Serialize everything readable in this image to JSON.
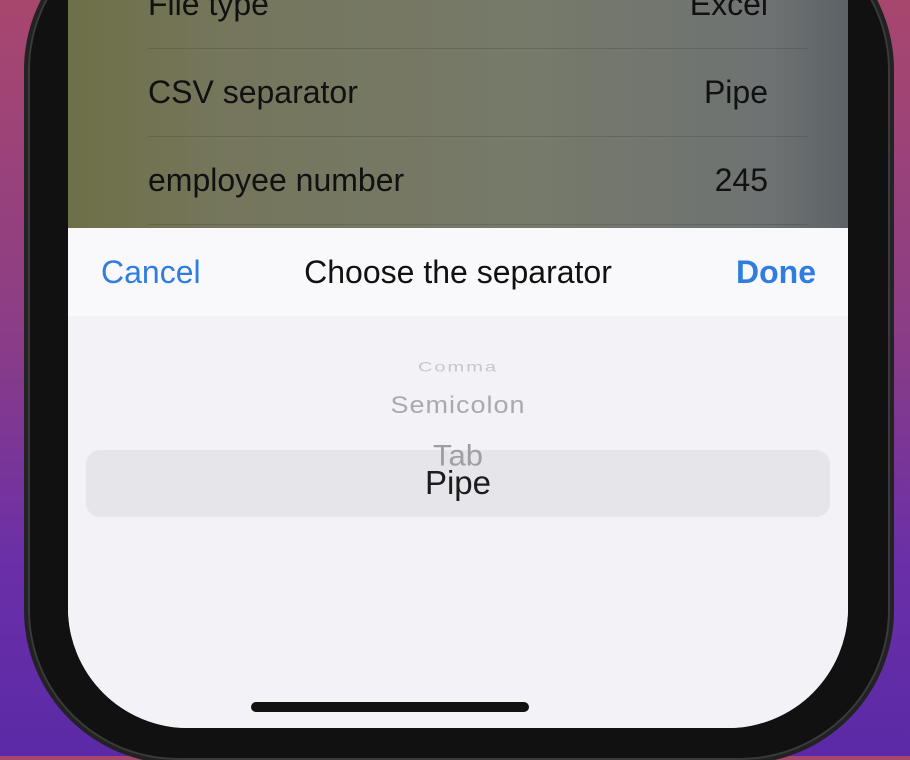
{
  "settings": {
    "rows": [
      {
        "label": "File type",
        "value": "Excel"
      },
      {
        "label": "CSV separator",
        "value": "Pipe"
      },
      {
        "label": "employee number",
        "value": "245"
      }
    ]
  },
  "toolbar": {
    "cancel_label": "Cancel",
    "title": "Choose the separator",
    "done_label": "Done"
  },
  "picker": {
    "options": [
      "Comma",
      "Semicolon",
      "Tab",
      "Pipe"
    ],
    "selected": "Pipe"
  },
  "colors": {
    "accent": "#2f7de1",
    "sheet_background": "#f2f2f7",
    "selection_band": "#e5e5ea"
  }
}
